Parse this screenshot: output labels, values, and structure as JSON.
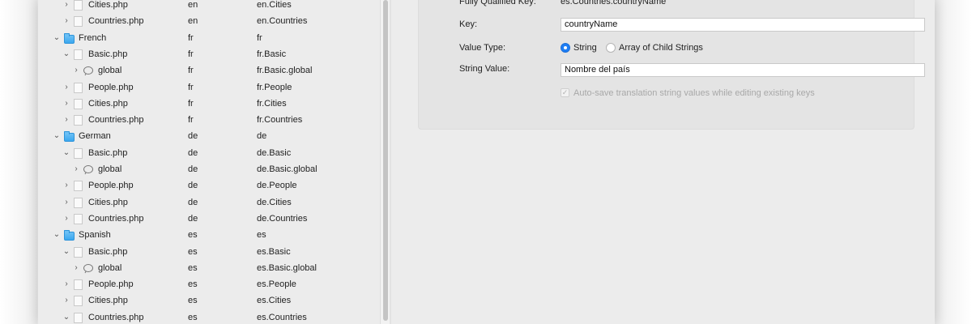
{
  "outline": {
    "rows": [
      {
        "depth": 1,
        "expanded": false,
        "icon": "file-icon",
        "name": "Cities.php",
        "code": "en",
        "key": "en.Cities"
      },
      {
        "depth": 1,
        "expanded": false,
        "icon": "file-icon",
        "name": "Countries.php",
        "code": "en",
        "key": "en.Countries"
      },
      {
        "depth": 0,
        "expanded": true,
        "icon": "folder-icon",
        "name": "French",
        "code": "fr",
        "key": "fr"
      },
      {
        "depth": 1,
        "expanded": true,
        "icon": "file-icon",
        "name": "Basic.php",
        "code": "fr",
        "key": "fr.Basic"
      },
      {
        "depth": 2,
        "expanded": false,
        "icon": "bubble-icon",
        "name": "global",
        "code": "fr",
        "key": "fr.Basic.global"
      },
      {
        "depth": 1,
        "expanded": false,
        "icon": "file-icon",
        "name": "People.php",
        "code": "fr",
        "key": "fr.People"
      },
      {
        "depth": 1,
        "expanded": false,
        "icon": "file-icon",
        "name": "Cities.php",
        "code": "fr",
        "key": "fr.Cities"
      },
      {
        "depth": 1,
        "expanded": false,
        "icon": "file-icon",
        "name": "Countries.php",
        "code": "fr",
        "key": "fr.Countries"
      },
      {
        "depth": 0,
        "expanded": true,
        "icon": "folder-icon",
        "name": "German",
        "code": "de",
        "key": "de"
      },
      {
        "depth": 1,
        "expanded": true,
        "icon": "file-icon",
        "name": "Basic.php",
        "code": "de",
        "key": "de.Basic"
      },
      {
        "depth": 2,
        "expanded": false,
        "icon": "bubble-icon",
        "name": "global",
        "code": "de",
        "key": "de.Basic.global"
      },
      {
        "depth": 1,
        "expanded": false,
        "icon": "file-icon",
        "name": "People.php",
        "code": "de",
        "key": "de.People"
      },
      {
        "depth": 1,
        "expanded": false,
        "icon": "file-icon",
        "name": "Cities.php",
        "code": "de",
        "key": "de.Cities"
      },
      {
        "depth": 1,
        "expanded": false,
        "icon": "file-icon",
        "name": "Countries.php",
        "code": "de",
        "key": "de.Countries"
      },
      {
        "depth": 0,
        "expanded": true,
        "icon": "folder-icon",
        "name": "Spanish",
        "code": "es",
        "key": "es"
      },
      {
        "depth": 1,
        "expanded": true,
        "icon": "file-icon",
        "name": "Basic.php",
        "code": "es",
        "key": "es.Basic"
      },
      {
        "depth": 2,
        "expanded": false,
        "icon": "bubble-icon",
        "name": "global",
        "code": "es",
        "key": "es.Basic.global"
      },
      {
        "depth": 1,
        "expanded": false,
        "icon": "file-icon",
        "name": "People.php",
        "code": "es",
        "key": "es.People"
      },
      {
        "depth": 1,
        "expanded": false,
        "icon": "file-icon",
        "name": "Cities.php",
        "code": "es",
        "key": "es.Cities"
      },
      {
        "depth": 1,
        "expanded": true,
        "icon": "file-icon",
        "name": "Countries.php",
        "code": "es",
        "key": "es.Countries"
      }
    ]
  },
  "detail": {
    "fqk_label": "Fully Qualified Key:",
    "fqk_value": "es.Countries.countryName",
    "key_label": "Key:",
    "key_value": "countryName",
    "value_type_label": "Value Type:",
    "option_string": "String",
    "option_array": "Array of Child Strings",
    "string_value_label": "String Value:",
    "string_value": "Nombre del país",
    "autosave_label": "Auto-save translation string values while editing existing keys"
  },
  "colors": {
    "accent": "#1e7ef5",
    "folder": "#3ba7ef"
  }
}
